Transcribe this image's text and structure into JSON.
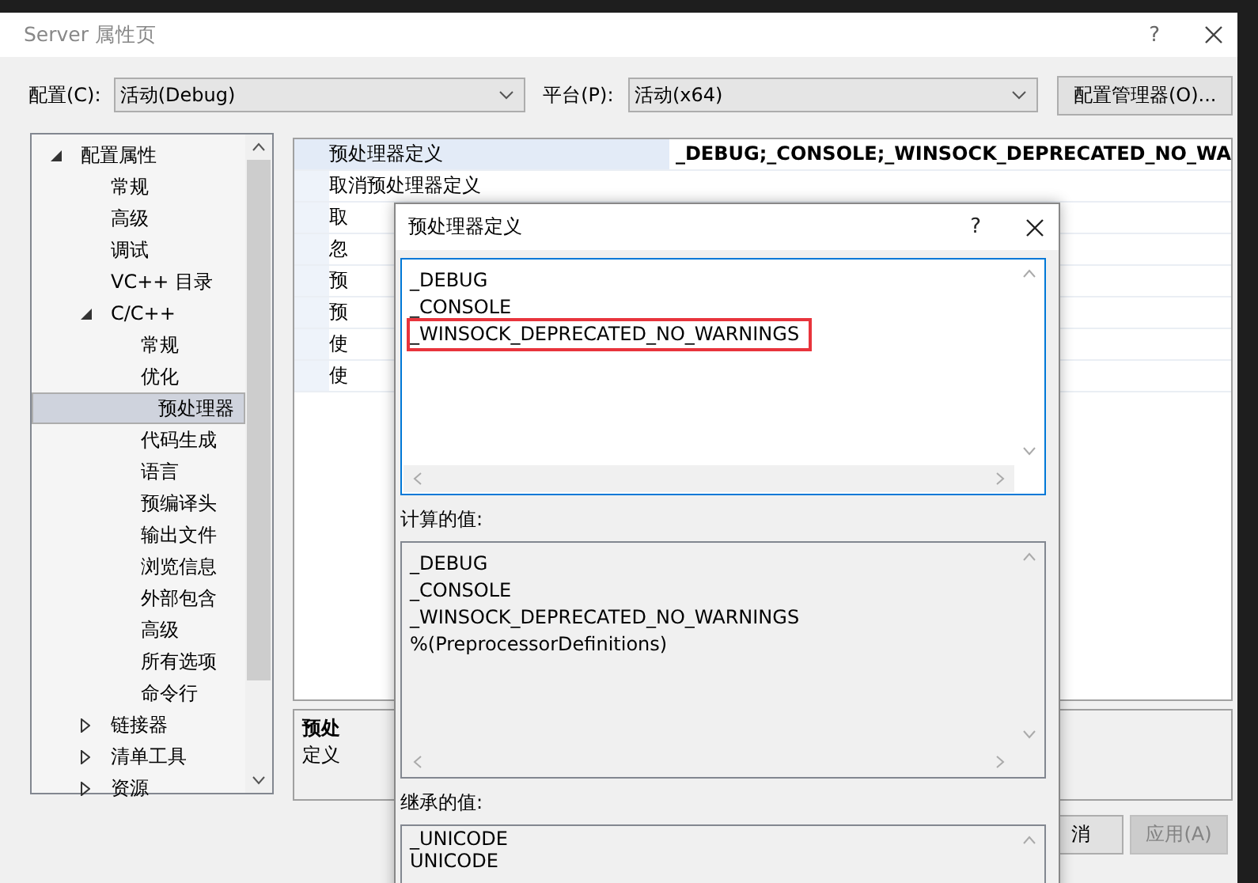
{
  "window": {
    "title": "Server 属性页",
    "help": "?"
  },
  "config": {
    "label": "配置(C):",
    "value": "活动(Debug)"
  },
  "platform": {
    "label": "平台(P):",
    "value": "活动(x64)"
  },
  "config_manager_button": "配置管理器(O)...",
  "tree": [
    {
      "label": "配置属性",
      "expanded": true,
      "selected": false,
      "children": [
        {
          "label": "常规",
          "selected": false
        },
        {
          "label": "高级",
          "selected": false
        },
        {
          "label": "调试",
          "selected": false
        },
        {
          "label": "VC++ 目录",
          "selected": false
        },
        {
          "label": "C/C++",
          "expanded": true,
          "selected": false,
          "children": [
            {
              "label": "常规",
              "selected": false
            },
            {
              "label": "优化",
              "selected": false
            },
            {
              "label": "预处理器",
              "selected": true
            },
            {
              "label": "代码生成",
              "selected": false
            },
            {
              "label": "语言",
              "selected": false
            },
            {
              "label": "预编译头",
              "selected": false
            },
            {
              "label": "输出文件",
              "selected": false
            },
            {
              "label": "浏览信息",
              "selected": false
            },
            {
              "label": "外部包含",
              "selected": false
            },
            {
              "label": "高级",
              "selected": false
            },
            {
              "label": "所有选项",
              "selected": false
            },
            {
              "label": "命令行",
              "selected": false
            }
          ]
        },
        {
          "label": "链接器",
          "expanded": false,
          "selected": false
        },
        {
          "label": "清单工具",
          "expanded": false,
          "selected": false
        },
        {
          "label": "资源",
          "expanded": false,
          "selected": false
        }
      ]
    }
  ],
  "property_grid": {
    "rows": [
      {
        "name": "预处理器定义",
        "value": "_DEBUG;_CONSOLE;_WINSOCK_DEPRECATED_NO_WA",
        "selected": true
      },
      {
        "name": "取消预处理器定义",
        "selected": false
      },
      {
        "name": "取",
        "selected": false
      },
      {
        "name": "忽",
        "selected": false
      },
      {
        "name": "预",
        "selected": false
      },
      {
        "name": "预",
        "selected": false
      },
      {
        "name": "使",
        "selected": false
      },
      {
        "name": "使",
        "selected": false
      }
    ]
  },
  "description": {
    "title": "预处",
    "text": "定义"
  },
  "buttons": [
    {
      "label": "消",
      "disabled": false
    },
    {
      "label": "应用(A)",
      "disabled": true
    }
  ],
  "dialog": {
    "title": "预处理器定义",
    "help": "?",
    "lines": [
      {
        "text": "_DEBUG",
        "highlighted": false
      },
      {
        "text": "_CONSOLE",
        "highlighted": false
      },
      {
        "text": "_WINSOCK_DEPRECATED_NO_WARNINGS",
        "highlighted": true
      }
    ],
    "computed_label": "计算的值:",
    "computed_lines": [
      "_DEBUG",
      "_CONSOLE",
      "_WINSOCK_DEPRECATED_NO_WARNINGS",
      "%(PreprocessorDefinitions)"
    ],
    "inherited_label": "继承的值:",
    "inherited_lines": [
      "_UNICODE",
      "UNICODE"
    ]
  }
}
